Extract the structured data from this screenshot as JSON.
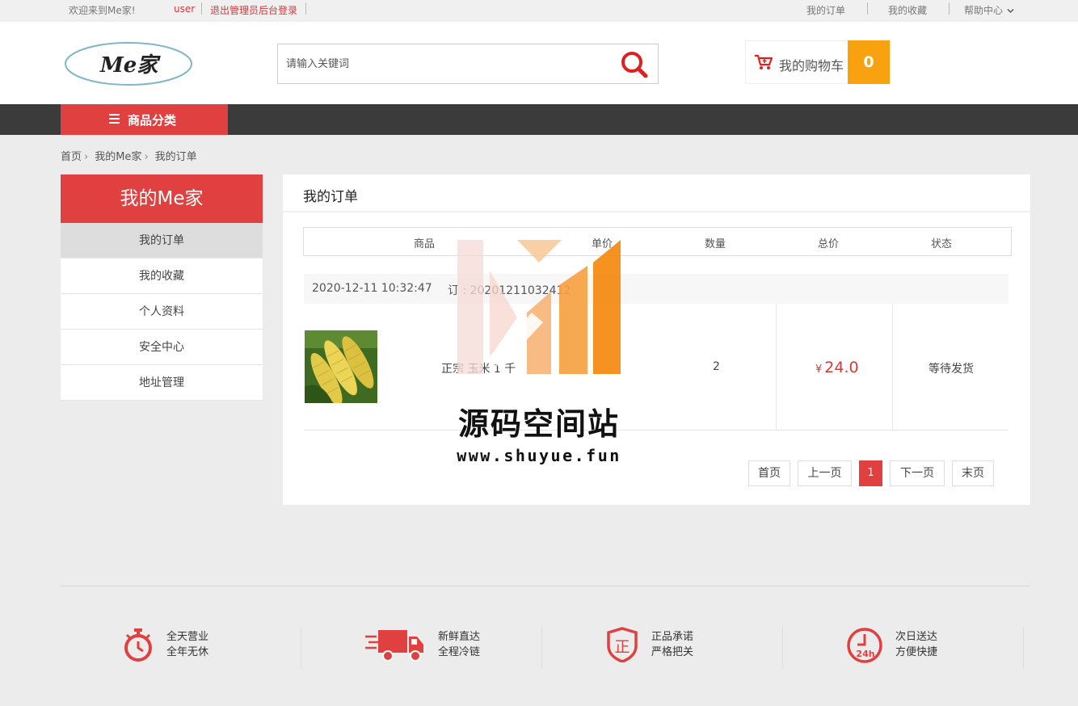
{
  "topbar": {
    "welcome": "欢迎来到Me家!",
    "username": "user",
    "logout": "退出管理员后台登录",
    "my_orders": "我的订单",
    "my_favorites": "我的收藏",
    "help_center": "帮助中心"
  },
  "header": {
    "logo_text": "Me家",
    "search_placeholder": "请输入关键词",
    "cart_label": "我的购物车",
    "cart_count": "0"
  },
  "nav": {
    "category_label": "商品分类"
  },
  "breadcrumb": [
    "首页",
    "我的Me家",
    "我的订单"
  ],
  "sidebar": {
    "title": "我的Me家",
    "items": [
      {
        "label": "我的订单",
        "active": true
      },
      {
        "label": "我的收藏",
        "active": false
      },
      {
        "label": "个人资料",
        "active": false
      },
      {
        "label": "安全中心",
        "active": false
      },
      {
        "label": "地址管理",
        "active": false
      }
    ]
  },
  "main": {
    "title": "我的订单",
    "columns": [
      "商品",
      "单价",
      "数量",
      "总价",
      "状态"
    ],
    "order": {
      "date": "2020-12-11 10:32:47",
      "number": "订  :  20201211032412",
      "product_name": "正宗         玉米       1    千",
      "quantity": "2",
      "currency": "¥",
      "total": "24.0",
      "status": "等待发货"
    },
    "pagination": [
      "首页",
      "上一页",
      "1",
      "下一页",
      "末页"
    ]
  },
  "watermark": {
    "title": "源码空间站",
    "url": "www.shuyue.fun"
  },
  "footer": {
    "features": [
      {
        "icon": "stopwatch-icon",
        "line1": "全天营业",
        "line2": "全年无休"
      },
      {
        "icon": "delivery-truck-icon",
        "line1": "新鲜直达",
        "line2": "全程冷链"
      },
      {
        "icon": "shield-icon",
        "line1": "正品承诺",
        "line2": "严格把关"
      },
      {
        "icon": "clock-24h-icon",
        "line1": "次日送达",
        "line2": "方便快捷"
      }
    ]
  },
  "colors": {
    "accent_red": "#e04040",
    "cart_orange": "#f7a20e",
    "nav_dark": "#3b3b3b"
  }
}
